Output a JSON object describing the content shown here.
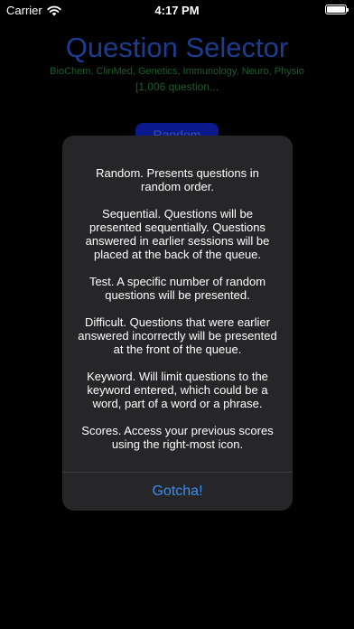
{
  "status_bar": {
    "carrier": "Carrier",
    "time": "4:17 PM"
  },
  "main": {
    "title": "Question Selector",
    "subtitle": "BioChem, ClinMed, Genetics, Immunology, Neuro, Physio",
    "question_count": "[1,006 question...",
    "random_button_label": "Random"
  },
  "alert": {
    "paragraphs": [
      "Random. Presents questions in random order.",
      "Sequential. Questions will be presented sequentially. Questions answered in earlier sessions will be placed at the back of the queue.",
      "Test. A specific number of random questions will be presented.",
      "Difficult. Questions that were earlier answered incorrectly will be presented at the front of the queue.",
      "Keyword. Will limit questions to the keyword entered, which could be a word, part of a word or a phrase.",
      "Scores. Access your previous scores using the right-most icon."
    ],
    "button_label": "Gotcha!"
  },
  "colors": {
    "title": "#1c3d8f",
    "subtitle": "#1f5c2b",
    "alert_background": "#262628",
    "alert_button": "#3a8ef0"
  }
}
